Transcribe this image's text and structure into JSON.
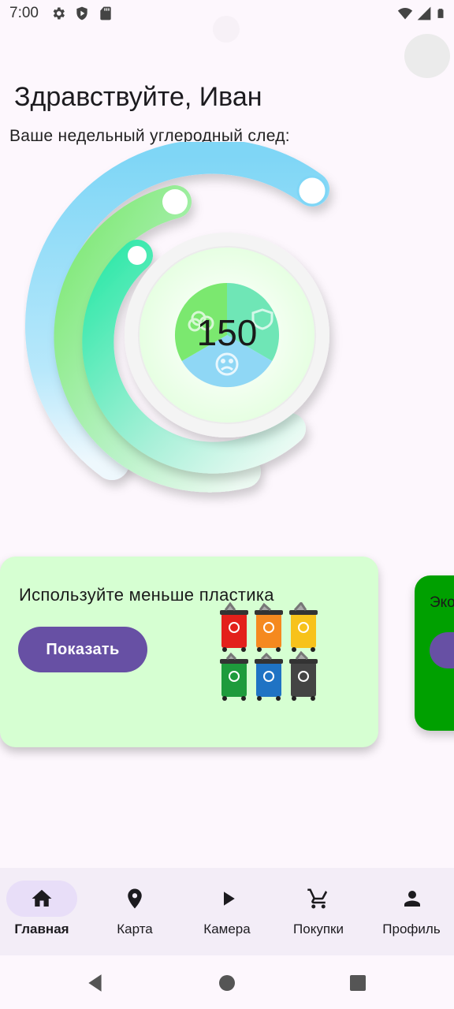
{
  "status_bar": {
    "time": "7:00",
    "left_icons": [
      "settings-icon",
      "shield-play-icon",
      "sd-card-icon"
    ],
    "right_icons": [
      "wifi-icon",
      "signal-icon",
      "battery-icon"
    ]
  },
  "header": {
    "greeting": "Здравствуйте, Иван"
  },
  "footprint": {
    "label": "Ваше недельный углеродный след:",
    "value": "150",
    "center_icons": [
      "tree-icon",
      "shield-icon",
      "sad-face-icon"
    ]
  },
  "cards": [
    {
      "title": "Используйте меньше пластика",
      "button_label": "Показать",
      "image": "recycle-bins-illustration",
      "background": "#d6ffd2"
    },
    {
      "title": "Эко",
      "background": "#00a000"
    }
  ],
  "bottom_nav": {
    "items": [
      {
        "label": "Главная",
        "icon": "home-icon",
        "active": true
      },
      {
        "label": "Карта",
        "icon": "map-pin-icon",
        "active": false
      },
      {
        "label": "Камера",
        "icon": "play-icon",
        "active": false
      },
      {
        "label": "Покупки",
        "icon": "cart-icon",
        "active": false
      },
      {
        "label": "Профиль",
        "icon": "person-icon",
        "active": false
      }
    ]
  },
  "system_nav": [
    "back-icon",
    "home-circle-icon",
    "recents-icon"
  ],
  "colors": {
    "accent": "#6750a4",
    "card_light_green": "#d6ffd2",
    "card_dark_green": "#00a000",
    "arc_blue": "#7fd6f6",
    "arc_green": "#7be86f",
    "arc_teal": "#2ee8a8"
  }
}
